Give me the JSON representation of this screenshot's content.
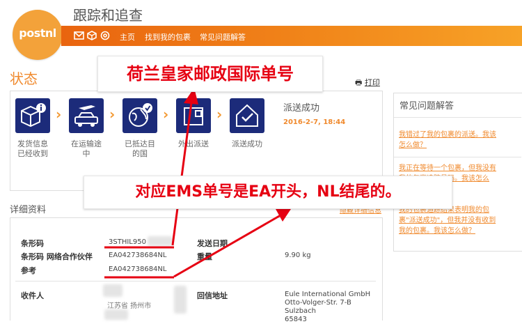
{
  "header": {
    "logo_text": "postnl",
    "title": "跟踪和追查",
    "nav": [
      "主页",
      "找到我的包裹",
      "常见问题解答"
    ],
    "nav_icons": [
      "mail-icon",
      "box-icon",
      "at-icon"
    ]
  },
  "status": {
    "title": "状态",
    "print_label": "打印",
    "steps": [
      {
        "label_line1": "发货信息",
        "label_line2": "已经收到",
        "icon": "package-info-icon"
      },
      {
        "label_line1": "在运输途",
        "label_line2": "中",
        "icon": "transport-icon"
      },
      {
        "label_line1": "已抵达目",
        "label_line2": "的国",
        "icon": "globe-icon"
      },
      {
        "label_line1": "外出派送",
        "label_line2": "",
        "icon": "delivery-box-icon"
      },
      {
        "label_line1": "派送成功",
        "label_line2": "",
        "icon": "house-check-icon"
      }
    ],
    "delivered_title": "派送成功",
    "delivered_date": "2016-2-7, 18:44"
  },
  "details": {
    "title": "详细资料",
    "hide_link": "隐藏详细信息",
    "barcode_label": "条形码",
    "barcode_value": "3STHIL950",
    "partner_label": "条形码 网络合作伙伴",
    "partner_value": "EA042738684NL",
    "reference_label": "参考",
    "reference_value": "EA042738684NL",
    "ship_date_label": "发送日期",
    "weight_label": "重量",
    "weight_value": "9.90 kg",
    "recipient_label": "收件人",
    "recipient_value": "江苏省 扬州市",
    "return_label": "回信地址",
    "return_lines": [
      "Eule International GmbH",
      "Otto-Volger-Str. 7-B",
      "Sulzbach",
      "65843"
    ]
  },
  "faq": {
    "title": "常见问题解答",
    "questions": [
      [
        "我错过了我的包裹的派送。我该",
        "怎么做？"
      ],
      [
        "我正在等待一个包裹，但我没有",
        "我的包裹追踪号码。我该怎么"
      ],
      [
        "我的包裹追踪结果表明我的包",
        "裹\"派送成功\"，但我并没有收到",
        "我的包裹。我该怎么做？"
      ]
    ]
  },
  "annotations": {
    "top": "荷兰皇家邮政国际单号",
    "middle": "对应EMS单号是EA开头，NL结尾的。"
  },
  "colors": {
    "accent": "#f08a2e",
    "navbar_start": "#e9640f",
    "navbar_end": "#f7a227",
    "icon_blue": "#1c2b7a",
    "annotation_red": "#e60012"
  }
}
